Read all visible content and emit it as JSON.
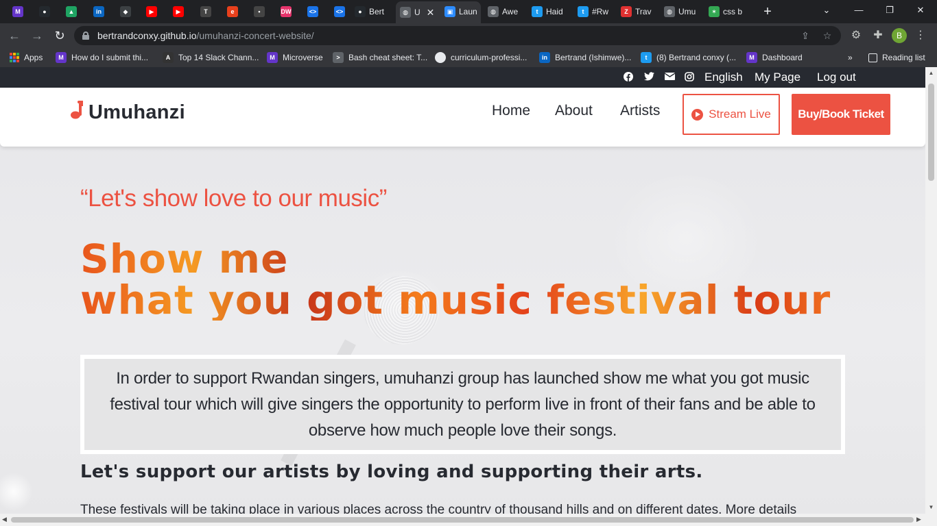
{
  "browser": {
    "tabs": [
      {
        "title": "",
        "favicon": "microverse-icon",
        "color": "#6435c9"
      },
      {
        "title": "",
        "favicon": "github-icon",
        "color": "#24292e"
      },
      {
        "title": "",
        "favicon": "google-drive-icon",
        "color": "#1fa463"
      },
      {
        "title": "",
        "favicon": "linkedin-icon",
        "color": "#0a66c2"
      },
      {
        "title": "",
        "favicon": "app-icon",
        "color": "#3c4043"
      },
      {
        "title": "",
        "favicon": "youtube-icon",
        "color": "#ff0000"
      },
      {
        "title": "",
        "favicon": "youtube-icon",
        "color": "#ff0000"
      },
      {
        "title": "",
        "favicon": "tech-icon",
        "color": "#444"
      },
      {
        "title": "",
        "favicon": "e-icon",
        "color": "#e8401c"
      },
      {
        "title": "",
        "favicon": "site-icon",
        "color": "#444"
      },
      {
        "title": "",
        "favicon": "dw-icon",
        "color": "#e6336b"
      },
      {
        "title": "",
        "favicon": "code-icon",
        "color": "#1a73e8"
      },
      {
        "title": "",
        "favicon": "code-icon",
        "color": "#1a73e8"
      },
      {
        "title": "Bert",
        "favicon": "github-icon",
        "color": "#24292e"
      },
      {
        "title": "U",
        "favicon": "globe-icon",
        "color": "#5f6368"
      },
      {
        "title": "Laun",
        "favicon": "zoom-icon",
        "color": "#2d8cff"
      },
      {
        "title": "Awe",
        "favicon": "globe-icon",
        "color": "#5f6368"
      },
      {
        "title": "Haid",
        "favicon": "twitter-icon",
        "color": "#1d9bf0"
      },
      {
        "title": "#Rw",
        "favicon": "twitter-icon",
        "color": "#1d9bf0"
      },
      {
        "title": "Trav",
        "favicon": "z-icon",
        "color": "#e03131"
      },
      {
        "title": "Umu",
        "favicon": "globe-icon",
        "color": "#5f6368"
      },
      {
        "title": "css b",
        "favicon": "star-icon",
        "color": "#34a853"
      }
    ],
    "url_host": "bertrandconxy.github.io",
    "url_path": "/umuhanzi-concert-website/",
    "profile_initial": "B",
    "bookmarks": [
      {
        "label": "Apps",
        "icon": "apps-grid-icon"
      },
      {
        "label": "How do I submit thi...",
        "icon": "microverse-icon"
      },
      {
        "label": "Top 14 Slack Chann...",
        "icon": "a-icon"
      },
      {
        "label": "Microverse",
        "icon": "microverse-icon"
      },
      {
        "label": "Bash cheat sheet: T...",
        "icon": "terminal-icon"
      },
      {
        "label": "curriculum-professi...",
        "icon": "github-icon"
      },
      {
        "label": "Bertrand (Ishimwe)...",
        "icon": "linkedin-icon"
      },
      {
        "label": "(8) Bertrand conxy (...",
        "icon": "twitter-icon"
      },
      {
        "label": "Dashboard",
        "icon": "microverse-icon"
      }
    ],
    "more_bookmarks": "»",
    "reading_list": "Reading list"
  },
  "site": {
    "topbar": {
      "language": "English",
      "my_page": "My Page",
      "logout": "Log out"
    },
    "logo_text": "Umuhanzi",
    "nav": {
      "home": "Home",
      "about": "About",
      "artists": "Artists",
      "stream_live": "Stream Live",
      "buy_ticket": "Buy/Book Ticket"
    },
    "accent": "#ec5242",
    "dark": "#272a31",
    "quote": "“Let's show love to our music”",
    "hero_line1": "Show me",
    "hero_line2": "what you got music festival tour",
    "description": "In order to support Rwandan singers, umuhanzi group has launched show me what you got music festival tour which will give singers the opportunity to perform live in front of their fans and be able to observe how much people love their songs.",
    "support_heading": "Let's support our artists by loving and supporting their arts.",
    "festivals_text": "These festivals will be taking place in various places across the country of thousand hills and on different dates. More details"
  }
}
